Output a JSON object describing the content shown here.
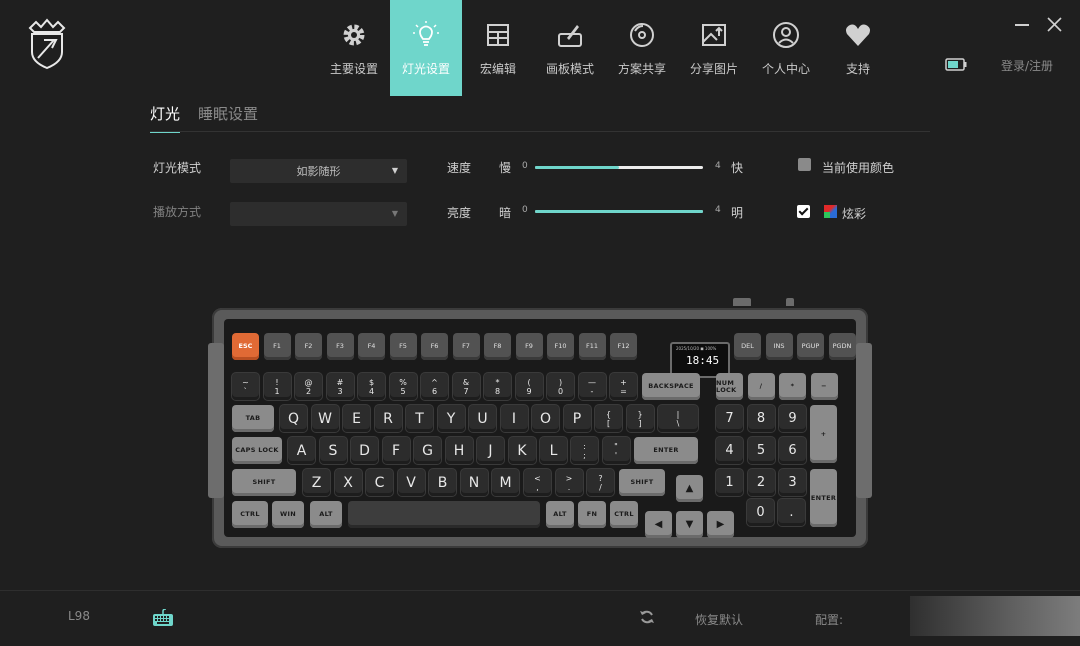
{
  "colors": {
    "accent": "#6fd6cb",
    "esc_key": "#e06a35",
    "background": "#1f1f1f"
  },
  "nav": [
    {
      "label": "主要设置",
      "icon": "gear-icon"
    },
    {
      "label": "灯光设置",
      "icon": "lightbulb-icon",
      "active": true
    },
    {
      "label": "宏编辑",
      "icon": "table-icon"
    },
    {
      "label": "画板模式",
      "icon": "palette-icon"
    },
    {
      "label": "方案共享",
      "icon": "share-disc-icon"
    },
    {
      "label": "分享图片",
      "icon": "image-upload-icon"
    },
    {
      "label": "个人中心",
      "icon": "user-icon"
    },
    {
      "label": "支持",
      "icon": "heart-icon"
    }
  ],
  "header": {
    "login": "登录/注册",
    "battery_icon": "battery-icon"
  },
  "subtabs": {
    "lighting": "灯光",
    "sleep": "睡眠设置"
  },
  "settings": {
    "mode_label": "灯光模式",
    "mode_value": "如影随形",
    "play_label": "播放方式",
    "play_value": "",
    "speed_label": "速度",
    "speed_slow": "慢",
    "speed_fast": "快",
    "speed_min": "0",
    "speed_max": "4",
    "speed_fraction": 0.5,
    "brightness_label": "亮度",
    "brightness_dark": "暗",
    "brightness_bright": "明",
    "brightness_min": "0",
    "brightness_max": "4",
    "brightness_fraction": 1.0,
    "use_current_color": "当前使用颜色",
    "use_current_color_checked": false,
    "colorful": "炫彩",
    "colorful_checked": true
  },
  "keyboard": {
    "screen_small": "2025/10/20  ◼ 100%",
    "screen_time": "18:45",
    "frow": [
      "ESC",
      "F1",
      "F2",
      "F3",
      "F4",
      "F5",
      "F6",
      "F7",
      "F8",
      "F9",
      "F10",
      "F11",
      "F12"
    ],
    "nav_top": [
      "DEL",
      "INS",
      "PGUP",
      "PGDN"
    ],
    "numrow": [
      [
        "~",
        "`"
      ],
      [
        "!",
        "1"
      ],
      [
        "@",
        "2"
      ],
      [
        "#",
        "3"
      ],
      [
        "$",
        "4"
      ],
      [
        "%",
        "5"
      ],
      [
        "^",
        "6"
      ],
      [
        "&",
        "7"
      ],
      [
        "*",
        "8"
      ],
      [
        "(",
        "9"
      ],
      [
        ")",
        "0"
      ],
      [
        "—",
        "-"
      ],
      [
        "+",
        "="
      ]
    ],
    "backspace": "BACKSPACE",
    "numpad_top": [
      "NUM LOCK",
      "/",
      "*",
      "−"
    ],
    "tab": "TAB",
    "qrow": [
      "Q",
      "W",
      "E",
      "R",
      "T",
      "Y",
      "U",
      "I",
      "O",
      "P"
    ],
    "qrow_sym": [
      [
        "{",
        "["
      ],
      [
        "}",
        "]"
      ],
      [
        "|",
        "\\"
      ]
    ],
    "numpad_row1": [
      "7",
      "8",
      "9",
      "+"
    ],
    "caps": "CAPS LOCK",
    "arow": [
      "A",
      "S",
      "D",
      "F",
      "G",
      "H",
      "J",
      "K",
      "L"
    ],
    "arow_sym": [
      [
        ":",
        ";"
      ],
      [
        "\"",
        "'"
      ]
    ],
    "enter": "ENTER",
    "numpad_row2": [
      "4",
      "5",
      "6"
    ],
    "shift": "SHIFT",
    "zrow": [
      "Z",
      "X",
      "C",
      "V",
      "B",
      "N",
      "M"
    ],
    "zrow_sym": [
      [
        "<",
        ","
      ],
      [
        ">",
        "."
      ],
      [
        "?",
        "/"
      ]
    ],
    "numpad_row3": [
      "1",
      "2",
      "3",
      "ENTER"
    ],
    "bottom_mods": [
      "CTRL",
      "WIN",
      "ALT",
      "ALT",
      "FN",
      "CTRL"
    ],
    "arrows": [
      "▲",
      "◀",
      "▼",
      "▶"
    ],
    "numpad_row4": [
      "0",
      "."
    ]
  },
  "footer": {
    "model": "L98",
    "reset": "恢复默认",
    "config": "配置:"
  }
}
